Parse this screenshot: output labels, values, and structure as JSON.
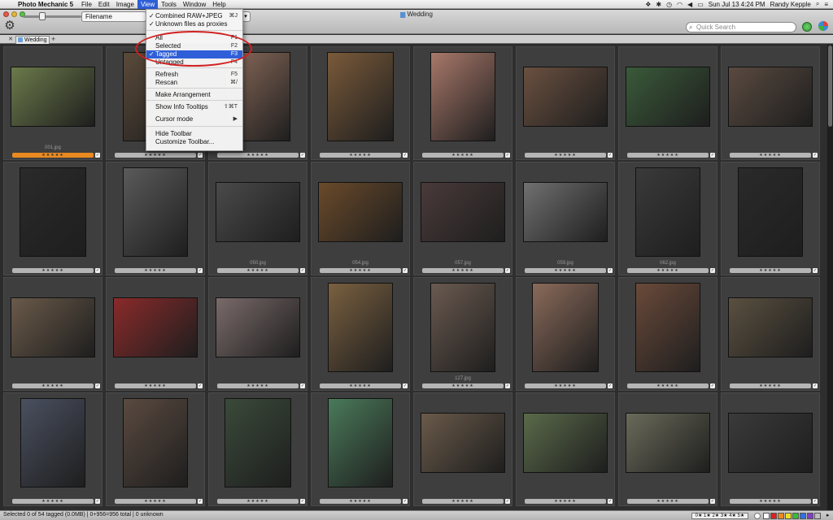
{
  "menubar": {
    "apple_icon": "apple-icon",
    "app_name": "Photo Mechanic 5",
    "items": [
      "File",
      "Edit",
      "Image",
      "View",
      "Tools",
      "Window",
      "Help"
    ],
    "active_item": "View",
    "clock": "Sun Jul 13  4:24 PM",
    "user": "Randy Kepple"
  },
  "window": {
    "title": "Wedding"
  },
  "toolbar": {
    "sort_field": "Filename",
    "search_placeholder": "Quick Search"
  },
  "tabs": [
    {
      "label": "Wedding"
    }
  ],
  "view_menu": {
    "items": [
      {
        "label": "Combined RAW+JPEG",
        "shortcut": "⌘J",
        "checked": true
      },
      {
        "label": "Unknown files as proxies",
        "shortcut": "",
        "checked": true
      },
      {
        "label": "All",
        "shortcut": "F1",
        "checked": false
      },
      {
        "label": "Selected",
        "shortcut": "F2",
        "checked": false
      },
      {
        "label": "Tagged",
        "shortcut": "F3",
        "checked": true,
        "highlighted": true
      },
      {
        "label": "Untagged",
        "shortcut": "F4",
        "checked": false
      },
      {
        "label": "Refresh",
        "shortcut": "F5",
        "checked": false
      },
      {
        "label": "Rescan",
        "shortcut": "⌘/",
        "checked": false
      },
      {
        "label": "Make Arrangement",
        "shortcut": "",
        "checked": false
      },
      {
        "label": "Show Info Tooltips",
        "shortcut": "⇧⌘T",
        "checked": false
      },
      {
        "label": "Cursor mode",
        "shortcut": "▶",
        "checked": false
      },
      {
        "label": "Hide Toolbar",
        "shortcut": "",
        "checked": false
      },
      {
        "label": "Customize Toolbar...",
        "shortcut": "",
        "checked": false
      }
    ]
  },
  "thumbnails": [
    {
      "file": "001.jpg",
      "color": "#6b7a4a",
      "tag": "orange"
    },
    {
      "file": "",
      "color": "#5a4a3a"
    },
    {
      "file": "",
      "color": "#8a6a5a"
    },
    {
      "file": "",
      "color": "#7a5a3a"
    },
    {
      "file": "",
      "color": "#a8786a"
    },
    {
      "file": "",
      "color": "#6a5040"
    },
    {
      "file": "",
      "color": "#3a5a3a"
    },
    {
      "file": "",
      "color": "#5a4a40"
    },
    {
      "file": "",
      "color": "#2a2a2a"
    },
    {
      "file": "",
      "color": "#5a5a5a"
    },
    {
      "file": "050.jpg",
      "color": "#4a4a4a"
    },
    {
      "file": "054.jpg",
      "color": "#6a4a2a"
    },
    {
      "file": "057.jpg",
      "color": "#4a3a3a"
    },
    {
      "file": "059.jpg",
      "color": "#707070"
    },
    {
      "file": "062.jpg",
      "color": "#3a3a3a"
    },
    {
      "file": "",
      "color": "#2a2a2a"
    },
    {
      "file": "",
      "color": "#6a5a4a"
    },
    {
      "file": "",
      "color": "#8a2a2a"
    },
    {
      "file": "",
      "color": "#7a6a6a"
    },
    {
      "file": "",
      "color": "#7a6040"
    },
    {
      "file": "127.jpg",
      "color": "#6a5a50"
    },
    {
      "file": "",
      "color": "#8a6a5a"
    },
    {
      "file": "",
      "color": "#6a4a3a"
    },
    {
      "file": "",
      "color": "#5a5040"
    },
    {
      "file": "",
      "color": "#4a5060"
    },
    {
      "file": "",
      "color": "#5a4a40"
    },
    {
      "file": "",
      "color": "#3a4a3a"
    },
    {
      "file": "",
      "color": "#4a7a5a"
    },
    {
      "file": "",
      "color": "#6a5a4a"
    },
    {
      "file": "",
      "color": "#5a6a4a"
    },
    {
      "file": "",
      "color": "#6a6a5a"
    },
    {
      "file": "",
      "color": "#3a3a3a"
    }
  ],
  "thumb_labels": {
    "001": "001.jpg",
    "050": "050.jpg",
    "054": "054.jpg",
    "057": "057.jpg",
    "059": "059.jpg",
    "062": "062.jpg",
    "127": "127.jpg"
  },
  "statusbar": {
    "text": "Selected 0 of 54 tagged (0.0MB) | 0+956=956 total | 0 unknown",
    "stars_filter": "0★ 1★ 2★ 3★ 4★ 5★",
    "swatch_colors": [
      "#ffffff",
      "#e02020",
      "#f08a20",
      "#f0e020",
      "#30c030",
      "#3070e0",
      "#8040c0",
      "#c0c0c0"
    ]
  }
}
